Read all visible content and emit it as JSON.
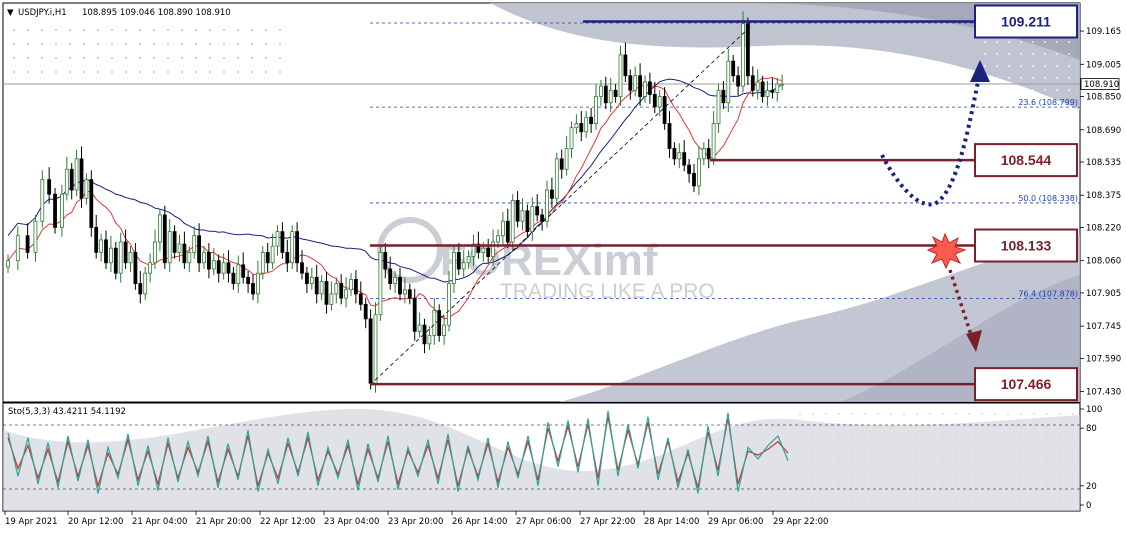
{
  "header": {
    "arrow": "▼",
    "symbol": "USDJPY.i,H1",
    "ohlc": "108.895 109.046 108.890 108.910"
  },
  "watermark": {
    "brand": "FOREXimf",
    "tagline": "TRADING LIKE A PRO"
  },
  "colors": {
    "bull": "#2e7d32",
    "bear": "#000000",
    "ma_fast": "#e53935",
    "ma_slow": "#1a237e",
    "fib": "#1f3fbf",
    "level_box_blue": "#1a237e",
    "level_box_red": "#7b1f2a",
    "stoch_main": "#26a69a",
    "stoch_signal": "#d32f2f"
  },
  "chart_data": [
    {
      "type": "candlestick",
      "title": "USDJPY.i,H1",
      "ylim": [
        107.38,
        109.3
      ],
      "price_ticks": [
        "109.165",
        "109.005",
        "108.850",
        "108.690",
        "108.535",
        "108.375",
        "108.220",
        "108.060",
        "107.905",
        "107.745",
        "107.590",
        "107.430"
      ],
      "current_price": "108.910",
      "x_ticks": [
        "19 Apr 2021",
        "20 Apr 12:00",
        "21 Apr 04:00",
        "21 Apr 20:00",
        "22 Apr 12:00",
        "23 Apr 04:00",
        "23 Apr 20:00",
        "26 Apr 14:00",
        "27 Apr 06:00",
        "27 Apr 22:00",
        "28 Apr 14:00",
        "29 Apr 06:00",
        "29 Apr 22:00"
      ],
      "fibonacci": [
        {
          "label": "23.6 (108.799)",
          "value": 108.799
        },
        {
          "label": "50.0 (108.338)",
          "value": 108.338
        },
        {
          "label": "76.4 (107.878)",
          "value": 107.878
        }
      ],
      "levels": [
        {
          "label": "109.211",
          "value": 109.211,
          "style": "blue"
        },
        {
          "label": "108.544",
          "value": 108.544,
          "style": "red"
        },
        {
          "label": "108.133",
          "value": 108.133,
          "style": "red"
        },
        {
          "label": "107.466",
          "value": 107.466,
          "style": "red"
        }
      ],
      "close_path": [
        [
          0,
          108.06
        ],
        [
          10,
          108.18
        ],
        [
          20,
          108.1
        ],
        [
          28,
          108.25
        ],
        [
          35,
          108.45
        ],
        [
          42,
          108.38
        ],
        [
          48,
          108.22
        ],
        [
          55,
          108.38
        ],
        [
          60,
          108.5
        ],
        [
          65,
          108.4
        ],
        [
          70,
          108.55
        ],
        [
          75,
          108.36
        ],
        [
          80,
          108.45
        ],
        [
          85,
          108.22
        ],
        [
          90,
          108.1
        ],
        [
          95,
          108.16
        ],
        [
          100,
          108.05
        ],
        [
          105,
          108.12
        ],
        [
          110,
          108.0
        ],
        [
          115,
          108.15
        ],
        [
          120,
          108.05
        ],
        [
          125,
          108.1
        ],
        [
          130,
          107.95
        ],
        [
          135,
          107.9
        ],
        [
          140,
          108.0
        ],
        [
          145,
          108.05
        ],
        [
          150,
          108.15
        ],
        [
          155,
          108.28
        ],
        [
          160,
          108.05
        ],
        [
          165,
          108.2
        ],
        [
          170,
          108.1
        ],
        [
          175,
          108.14
        ],
        [
          180,
          108.05
        ],
        [
          185,
          108.1
        ],
        [
          190,
          108.18
        ],
        [
          195,
          108.05
        ],
        [
          200,
          108.1
        ],
        [
          205,
          108.02
        ],
        [
          210,
          108.06
        ],
        [
          215,
          108.0
        ],
        [
          220,
          108.05
        ],
        [
          225,
          108.0
        ],
        [
          230,
          107.95
        ],
        [
          235,
          108.04
        ],
        [
          240,
          107.98
        ],
        [
          245,
          107.95
        ],
        [
          250,
          107.9
        ],
        [
          255,
          108.0
        ],
        [
          260,
          108.1
        ],
        [
          265,
          108.05
        ],
        [
          270,
          108.13
        ],
        [
          275,
          108.2
        ],
        [
          280,
          108.1
        ],
        [
          285,
          108.05
        ],
        [
          290,
          108.2
        ],
        [
          295,
          108.05
        ],
        [
          300,
          108.0
        ],
        [
          305,
          107.95
        ],
        [
          310,
          107.98
        ],
        [
          315,
          107.9
        ],
        [
          320,
          107.96
        ],
        [
          325,
          107.85
        ],
        [
          330,
          107.9
        ],
        [
          335,
          107.95
        ],
        [
          340,
          107.88
        ],
        [
          345,
          107.92
        ],
        [
          350,
          107.97
        ],
        [
          355,
          107.9
        ],
        [
          360,
          107.85
        ],
        [
          365,
          107.78
        ],
        [
          370,
          107.47
        ],
        [
          375,
          107.8
        ],
        [
          380,
          108.1
        ],
        [
          385,
          108.02
        ],
        [
          390,
          107.95
        ],
        [
          395,
          107.98
        ],
        [
          400,
          107.9
        ],
        [
          405,
          107.92
        ],
        [
          410,
          107.88
        ],
        [
          415,
          107.72
        ],
        [
          420,
          107.75
        ],
        [
          425,
          107.66
        ],
        [
          430,
          107.7
        ],
        [
          435,
          107.82
        ],
        [
          440,
          107.7
        ],
        [
          445,
          107.75
        ],
        [
          450,
          107.95
        ],
        [
          455,
          108.1
        ],
        [
          460,
          108.02
        ],
        [
          465,
          108.05
        ],
        [
          470,
          108.08
        ],
        [
          475,
          108.14
        ],
        [
          480,
          108.1
        ],
        [
          485,
          108.12
        ],
        [
          490,
          108.08
        ],
        [
          495,
          108.15
        ],
        [
          500,
          108.18
        ],
        [
          505,
          108.25
        ],
        [
          510,
          108.15
        ],
        [
          515,
          108.35
        ],
        [
          520,
          108.25
        ],
        [
          525,
          108.3
        ],
        [
          530,
          108.2
        ],
        [
          535,
          108.32
        ],
        [
          540,
          108.28
        ],
        [
          545,
          108.25
        ],
        [
          550,
          108.4
        ],
        [
          555,
          108.36
        ],
        [
          560,
          108.55
        ],
        [
          565,
          108.5
        ],
        [
          570,
          108.6
        ],
        [
          575,
          108.7
        ],
        [
          580,
          108.72
        ],
        [
          585,
          108.68
        ],
        [
          590,
          108.75
        ],
        [
          595,
          108.72
        ],
        [
          600,
          108.85
        ],
        [
          605,
          108.9
        ],
        [
          610,
          108.82
        ],
        [
          615,
          108.88
        ],
        [
          620,
          108.85
        ],
        [
          625,
          109.05
        ],
        [
          630,
          108.95
        ],
        [
          635,
          108.88
        ],
        [
          640,
          108.95
        ],
        [
          645,
          108.85
        ],
        [
          650,
          108.92
        ],
        [
          655,
          108.86
        ],
        [
          660,
          108.8
        ],
        [
          665,
          108.85
        ],
        [
          670,
          108.72
        ],
        [
          675,
          108.6
        ],
        [
          680,
          108.55
        ],
        [
          685,
          108.58
        ],
        [
          690,
          108.52
        ],
        [
          695,
          108.48
        ],
        [
          700,
          108.42
        ],
        [
          705,
          108.55
        ],
        [
          710,
          108.6
        ],
        [
          715,
          108.55
        ],
        [
          720,
          108.72
        ],
        [
          725,
          108.88
        ],
        [
          730,
          108.82
        ],
        [
          735,
          109.02
        ],
        [
          740,
          108.95
        ],
        [
          745,
          108.9
        ],
        [
          750,
          109.2
        ],
        [
          755,
          108.95
        ],
        [
          760,
          108.88
        ],
        [
          765,
          108.92
        ],
        [
          770,
          108.85
        ],
        [
          775,
          108.88
        ],
        [
          780,
          108.87
        ],
        [
          785,
          108.91
        ],
        [
          790,
          108.91
        ]
      ]
    },
    {
      "type": "line",
      "title": "Sto(5,3,3) 43.4211 54.1192",
      "ylim": [
        0,
        100
      ],
      "levels": [
        80,
        20
      ],
      "ticks": [
        "100",
        "80",
        "20",
        "0"
      ],
      "series": [
        {
          "name": "Sto main",
          "values": [
            75,
            30,
            70,
            22,
            65,
            18,
            72,
            25,
            68,
            12,
            60,
            28,
            74,
            20,
            62,
            15,
            70,
            24,
            66,
            30,
            72,
            18,
            64,
            26,
            78,
            14,
            58,
            22,
            70,
            30,
            76,
            20,
            60,
            28,
            68,
            15,
            64,
            24,
            72,
            16,
            60,
            30,
            68,
            22,
            74,
            14,
            62,
            26,
            70,
            18,
            66,
            28,
            72,
            20,
            86,
            40,
            88,
            34,
            90,
            20,
            98,
            30,
            84,
            38,
            92,
            26,
            70,
            18,
            58,
            12,
            82,
            30,
            96,
            14,
            60,
            48,
            62,
            72,
            46
          ]
        },
        {
          "name": "Sto signal",
          "values": [
            70,
            38,
            62,
            28,
            58,
            24,
            66,
            30,
            62,
            20,
            54,
            32,
            68,
            26,
            56,
            22,
            64,
            28,
            60,
            34,
            66,
            24,
            58,
            30,
            72,
            20,
            54,
            28,
            64,
            34,
            70,
            26,
            56,
            32,
            62,
            22,
            58,
            28,
            66,
            22,
            56,
            34,
            62,
            28,
            68,
            20,
            58,
            30,
            64,
            24,
            60,
            32,
            66,
            26,
            80,
            46,
            82,
            40,
            84,
            28,
            92,
            36,
            78,
            42,
            86,
            32,
            66,
            24,
            54,
            18,
            76,
            36,
            90,
            22,
            56,
            52,
            58,
            66,
            54
          ]
        }
      ]
    }
  ]
}
